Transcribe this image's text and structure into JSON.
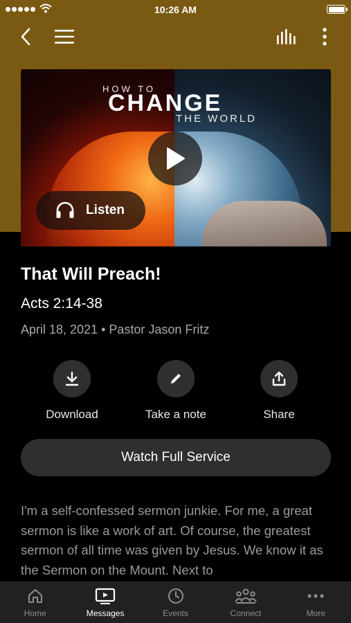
{
  "status_bar": {
    "time": "10:26 AM"
  },
  "hero": {
    "art_line1": "HOW TO",
    "art_line2": "CHANGE",
    "art_line3": "THE WORLD",
    "listen_label": "Listen"
  },
  "sermon": {
    "title": "That Will Preach!",
    "scripture": "Acts 2:14-38",
    "meta": "April 18, 2021 • Pastor Jason Fritz"
  },
  "actions": {
    "download_label": "Download",
    "note_label": "Take a note",
    "share_label": "Share"
  },
  "watch_button": "Watch Full Service",
  "description": "I'm a self-confessed sermon junkie. For me, a great sermon is like a work of art. Of course, the greatest sermon of all time was given by Jesus. We know it as the Sermon on the Mount. Next to",
  "tabs": [
    {
      "label": "Home",
      "icon": "home-icon"
    },
    {
      "label": "Messages",
      "icon": "tv-icon",
      "active": true
    },
    {
      "label": "Events",
      "icon": "clock-icon"
    },
    {
      "label": "Connect",
      "icon": "people-icon"
    },
    {
      "label": "More",
      "icon": "more-dots-icon"
    }
  ],
  "colors": {
    "header_bg": "#7a5a13",
    "background": "#000000",
    "button_bg": "#2f2f2f",
    "tab_bar_bg": "#212121",
    "muted_text": "#a8a8a8"
  }
}
